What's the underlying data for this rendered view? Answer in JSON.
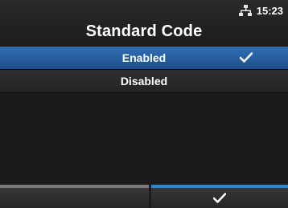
{
  "header": {
    "title": "Standard Code",
    "time": "15:23",
    "network_icon": "network-icon"
  },
  "options": [
    {
      "label": "Enabled",
      "selected": true,
      "icon": "checkmark-icon"
    },
    {
      "label": "Disabled",
      "selected": false
    }
  ],
  "softkeys": {
    "left_accent_color": "#7a7a7a",
    "right_accent_color": "#2a86d4",
    "right_icon": "checkmark-icon"
  },
  "colors": {
    "selected_row": "#2f6fb5",
    "background": "#1b1b1b"
  }
}
